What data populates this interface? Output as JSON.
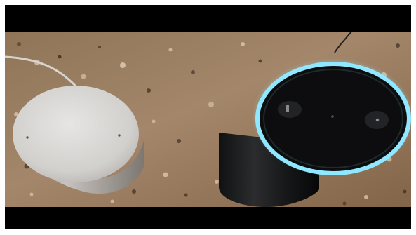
{
  "photo": {
    "subject": "",
    "colors": {
      "counter_base": "#9b8063",
      "counter_dark": "#4c3d2e",
      "counter_light": "#d6c3ab",
      "letterbox": "#000000",
      "cylinder_body": "#1b1b1c",
      "cylinder_top": "#0d0d0f",
      "light_ring": "#8fe8ff",
      "round_speaker_top": "#d9d8d6",
      "round_speaker_side": "#b7b4b0",
      "cable": "#d7d3cf"
    }
  }
}
